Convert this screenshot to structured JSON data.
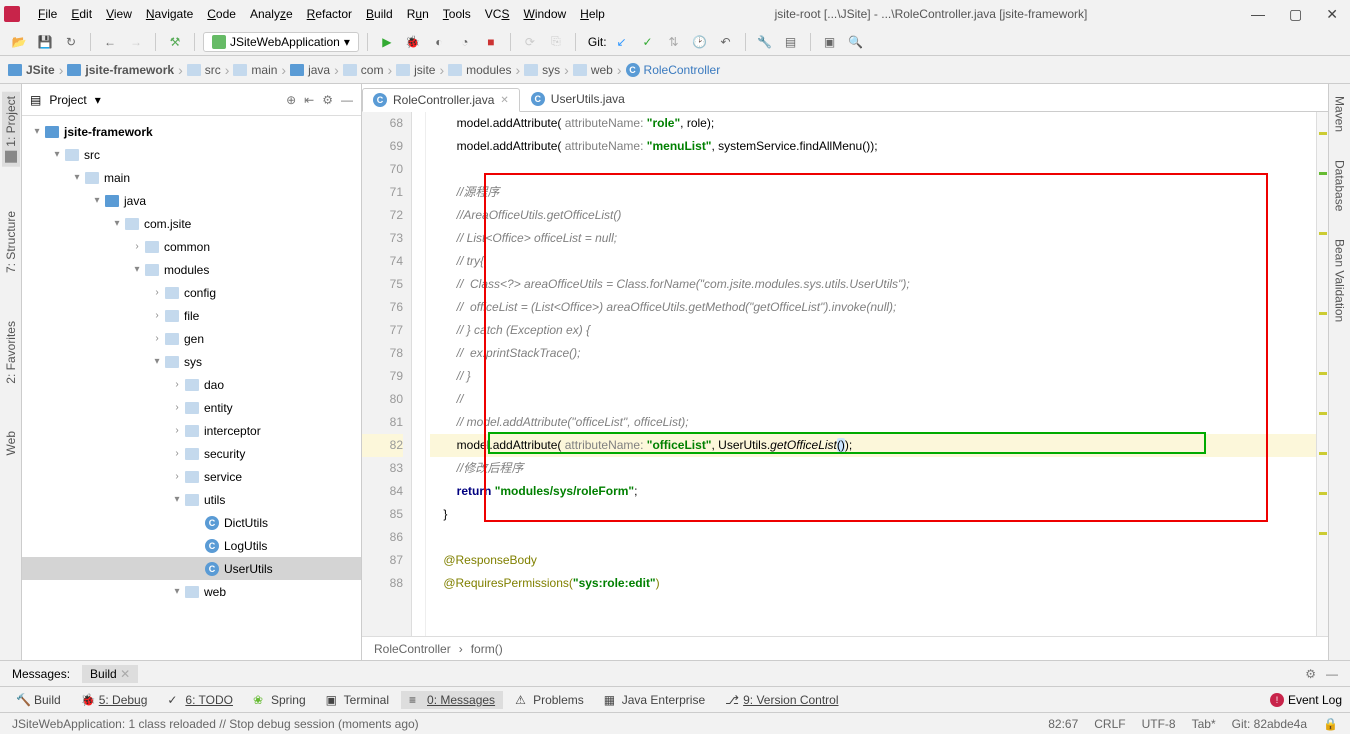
{
  "menu": [
    "File",
    "Edit",
    "View",
    "Navigate",
    "Code",
    "Analyze",
    "Refactor",
    "Build",
    "Run",
    "Tools",
    "VCS",
    "Window",
    "Help"
  ],
  "window_title": "jsite-root [...\\JSite] - ...\\RoleController.java [jsite-framework]",
  "run_config": "JSiteWebApplication",
  "git_label": "Git:",
  "breadcrumb": [
    "JSite",
    "jsite-framework",
    "src",
    "main",
    "java",
    "com",
    "jsite",
    "modules",
    "sys",
    "web",
    "RoleController"
  ],
  "project_panel_title": "Project",
  "tree": {
    "root": "jsite-framework",
    "src": "src",
    "main": "main",
    "java": "java",
    "pkg": "com.jsite",
    "common": "common",
    "modules": "modules",
    "config": "config",
    "file": "file",
    "gen": "gen",
    "sys": "sys",
    "dao": "dao",
    "entity": "entity",
    "interceptor": "interceptor",
    "security": "security",
    "service": "service",
    "utils": "utils",
    "DictUtils": "DictUtils",
    "LogUtils": "LogUtils",
    "UserUtils": "UserUtils",
    "web": "web"
  },
  "sidebar_left": {
    "project": "1: Project",
    "structure": "7: Structure",
    "favorites": "2: Favorites",
    "web": "Web"
  },
  "sidebar_right": {
    "maven": "Maven",
    "database": "Database",
    "bean": "Bean Validation"
  },
  "editor_tabs": [
    {
      "name": "RoleController.java",
      "active": true
    },
    {
      "name": "UserUtils.java",
      "active": false
    }
  ],
  "gutter_lines": [
    "68",
    "69",
    "70",
    "71",
    "72",
    "73",
    "74",
    "75",
    "76",
    "77",
    "78",
    "79",
    "80",
    "81",
    "82",
    "83",
    "84",
    "85",
    "86",
    "87",
    "88"
  ],
  "code": {
    "l68_a": "        model.addAttribute( ",
    "l68_p": "attributeName: ",
    "l68_s": "\"role\"",
    "l68_b": ", role);",
    "l69_a": "        model.addAttribute( ",
    "l69_p": "attributeName: ",
    "l69_s": "\"menuList\"",
    "l69_b": ", systemService.findAllMenu());",
    "l71": "        //源程序",
    "l72": "        //AreaOfficeUtils.getOfficeList()",
    "l73": "        // List<Office> officeList = null;",
    "l74": "        // try{",
    "l75": "        //  Class<?> areaOfficeUtils = Class.forName(\"com.jsite.modules.sys.utils.UserUtils\");",
    "l76": "        //  officeList = (List<Office>) areaOfficeUtils.getMethod(\"getOfficeList\").invoke(null);",
    "l77": "        // } catch (Exception ex) {",
    "l78": "        //  ex.printStackTrace();",
    "l79": "        // }",
    "l80": "        //",
    "l81": "        // model.addAttribute(\"officeList\", officeList);",
    "l82_a": "        model.addAttribute( ",
    "l82_p": "attributeName: ",
    "l82_s": "\"officeList\"",
    "l82_b": ", UserUtils.",
    "l82_m": "getOfficeList",
    "l82_c": "()",
    "l82_d": ");",
    "l83": "        //修改后程序",
    "l84_a": "        ",
    "l84_k": "return ",
    "l84_s": "\"modules/sys/roleForm\"",
    "l84_b": ";",
    "l85": "    }",
    "l87": "    @ResponseBody",
    "l88_a": "    @RequiresPermissions(",
    "l88_s": "\"sys:role:edit\"",
    "l88_b": ")"
  },
  "editor_breadcrumb": [
    "RoleController",
    "form()"
  ],
  "messages_label": "Messages:",
  "messages_tab": "Build",
  "bottom_tools": {
    "build": "Build",
    "debug": "5: Debug",
    "todo": "6: TODO",
    "spring": "Spring",
    "terminal": "Terminal",
    "messages": "0: Messages",
    "problems": "Problems",
    "enterprise": "Java Enterprise",
    "vcs": "9: Version Control"
  },
  "event_log": "Event Log",
  "status_left": "JSiteWebApplication: 1 class reloaded // Stop debug session (moments ago)",
  "status_right": {
    "pos": "82:67",
    "enc": "CRLF",
    "enc2": "UTF-8",
    "tab": "Tab*",
    "git": "Git: 82abde4a"
  }
}
